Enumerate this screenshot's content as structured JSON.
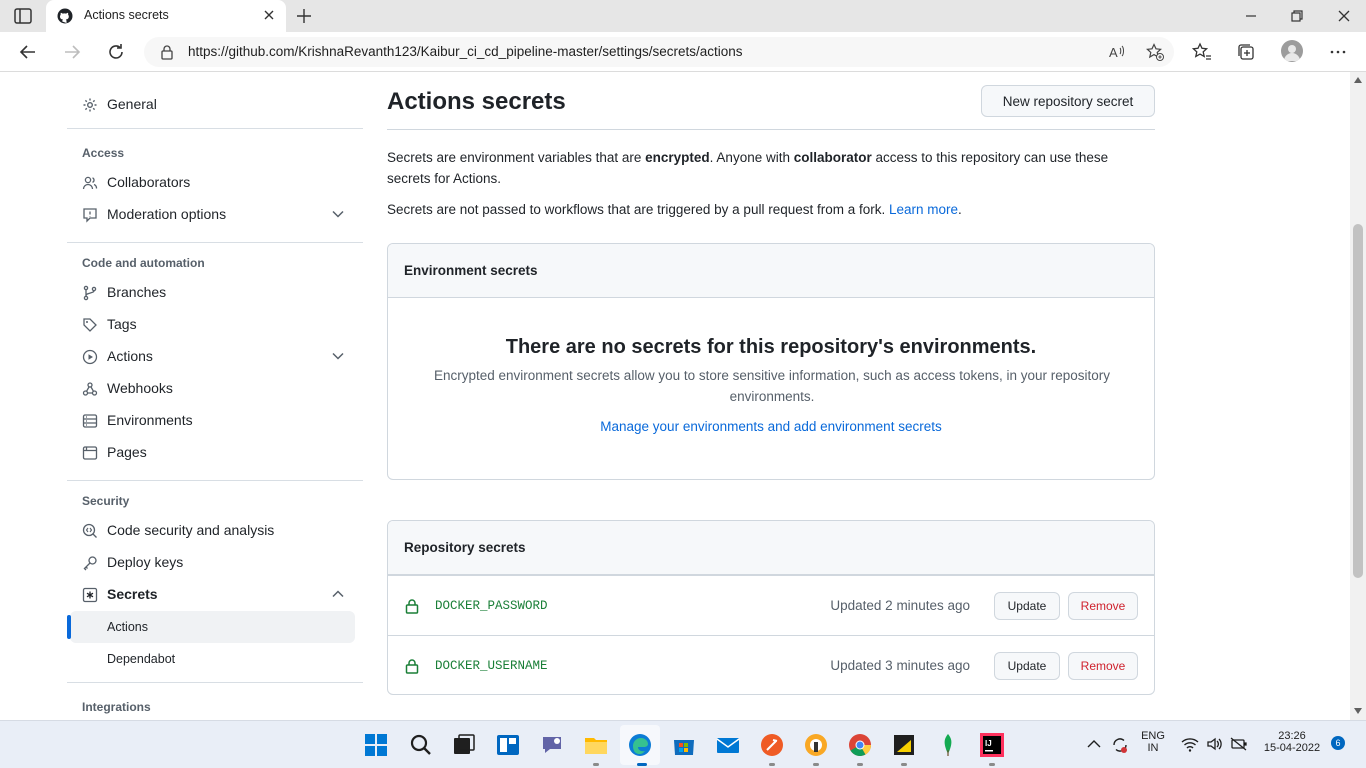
{
  "browser": {
    "tab_title": "Actions secrets",
    "url": "https://github.com/KrishnaRevanth123/Kaibur_ci_cd_pipeline-master/settings/secrets/actions"
  },
  "sidebar": {
    "general": "General",
    "access_title": "Access",
    "collaborators": "Collaborators",
    "moderation": "Moderation options",
    "code_title": "Code and automation",
    "branches": "Branches",
    "tags": "Tags",
    "actions": "Actions",
    "webhooks": "Webhooks",
    "environments": "Environments",
    "pages": "Pages",
    "security_title": "Security",
    "code_security": "Code security and analysis",
    "deploy_keys": "Deploy keys",
    "secrets": "Secrets",
    "secrets_actions": "Actions",
    "secrets_dependabot": "Dependabot",
    "integrations_title": "Integrations"
  },
  "main": {
    "title": "Actions secrets",
    "new_secret_button": "New repository secret",
    "intro": {
      "p1_a": "Secrets are environment variables that are ",
      "p1_b": "encrypted",
      "p1_c": ". Anyone with ",
      "p1_d": "collaborator",
      "p1_e": " access to this repository can use these secrets for Actions.",
      "p2_a": "Secrets are not passed to workflows that are triggered by a pull request from a fork. ",
      "p2_link": "Learn more",
      "p2_end": "."
    },
    "env_box": {
      "header": "Environment secrets",
      "blank_title": "There are no secrets for this repository's environments.",
      "blank_desc": "Encrypted environment secrets allow you to store sensitive information, such as access tokens, in your repository environments.",
      "blank_link": "Manage your environments and add environment secrets"
    },
    "repo_box": {
      "header": "Repository secrets",
      "secrets": [
        {
          "name": "DOCKER_PASSWORD",
          "updated": "Updated 2 minutes ago",
          "update_label": "Update",
          "remove_label": "Remove"
        },
        {
          "name": "DOCKER_USERNAME",
          "updated": "Updated 3 minutes ago",
          "update_label": "Update",
          "remove_label": "Remove"
        }
      ]
    }
  },
  "taskbar": {
    "lang_top": "ENG",
    "lang_bottom": "IN",
    "time": "23:26",
    "date": "15-04-2022",
    "notifications": "6"
  },
  "colors": {
    "accent": "#0969da",
    "success": "#1a7f37",
    "danger": "#cf222e"
  }
}
